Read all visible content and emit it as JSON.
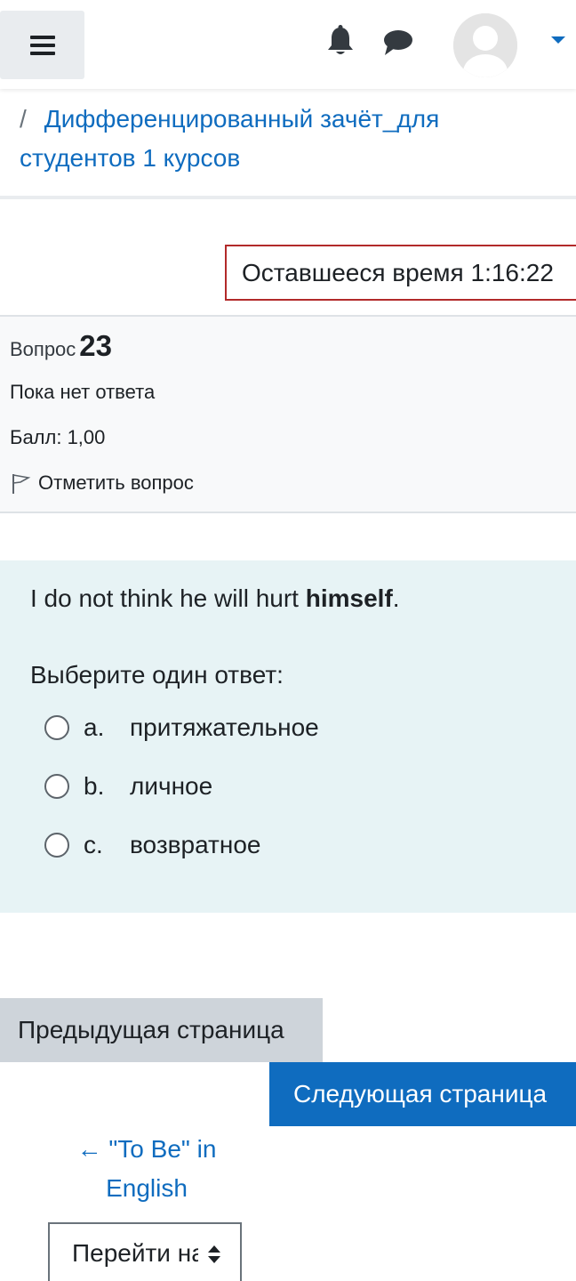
{
  "header": {
    "menu_icon": "hamburger-icon",
    "notification_icon": "bell-icon",
    "messages_icon": "chat-bubble-icon",
    "user_icon": "avatar-icon",
    "accent_color": "#0f6cbf"
  },
  "breadcrumb": {
    "separator": "/",
    "course": "Дифференцированный зачёт_для студентов 1 курсов"
  },
  "timer": {
    "label": "Оставшееся время",
    "value": "1:16:22"
  },
  "question": {
    "label": "Вопрос",
    "number": "23",
    "state": "Пока нет ответа",
    "grade": "Балл: 1,00",
    "flag_label": "Отметить вопрос",
    "text_before": "I do not think he will hurt ",
    "text_bold": "himself",
    "text_after": ".",
    "prompt": "Выберите один ответ:",
    "options": [
      {
        "letter": "a.",
        "label": "притяжательное"
      },
      {
        "letter": "b.",
        "label": "личное"
      },
      {
        "letter": "c.",
        "label": "возвратное"
      }
    ]
  },
  "navigation": {
    "prev_label": "Предыдущая страница",
    "next_label": "Следующая страница",
    "prev_activity": "← \"To Be\" in English",
    "jump_label": "Перейти на..."
  }
}
